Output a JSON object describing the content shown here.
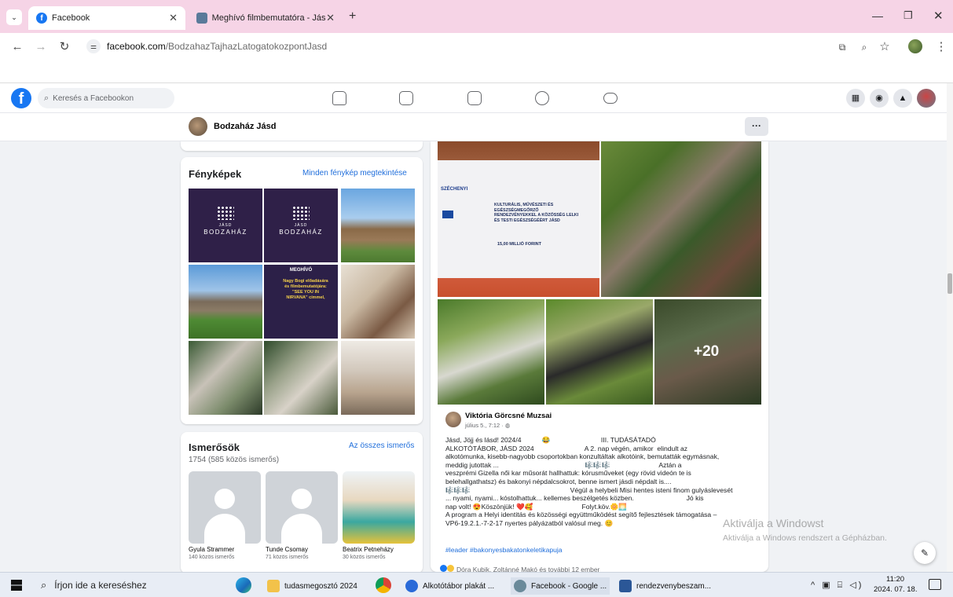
{
  "browser": {
    "tabs": [
      {
        "label": "Facebook"
      },
      {
        "label": "Meghívó filmbemutatóra - Jásd"
      }
    ],
    "url_domain": "facebook.com",
    "url_path": "/BodzahazTajhazLatogatokozpontJasd"
  },
  "fb": {
    "search_placeholder": "Keresés a Facebookon",
    "page_name": "Bodzaház Jásd",
    "more_label": "···"
  },
  "photos": {
    "title": "Fényképek",
    "see_all": "Minden fénykép megtekintése",
    "logo_text": "BODZAHÁZ",
    "logo_small": "JÁSD",
    "invite_head": "MEGHÍVÓ",
    "invite_body": "Nagy Bogi előadására és filmbemutatójára: \"SEE YOU IN NIRVANA\" címmel,"
  },
  "friends": {
    "title": "Ismerősök",
    "count": "1754 (585 közös ismerős)",
    "see_all": "Az összes ismerős",
    "items": [
      {
        "name": "Gyula Strammer",
        "mutual": "140 közös ismerős"
      },
      {
        "name": "Tunde Csomay",
        "mutual": "71 közös ismerős"
      },
      {
        "name": "Beatrix Petneházy",
        "mutual": "30 közös ismerős"
      }
    ]
  },
  "post": {
    "poster_text": "KULTURÁLIS, MŰVÉSZETI ÉS EGÉSZSÉGMEGŐRZŐ RENDEZVÉNYEKKEL A KÖZÖSSÉG LELKI ÉS TESTI EGÉSZSÉGÉÉRT JÁSD",
    "poster_amount": "15,00 MILLIÓ FORINT",
    "poster_brand": "SZÉCHENYI",
    "more_count": "+20",
    "author": "Viktória Görcsné Muzsai",
    "date": "július 5., 7:12 · ",
    "text": "Jásd, Jöjj és lásd! 2024/4           😂                           III. TUDÁSÁTADÓ\nALKOTÓTÁBOR, JÁSD 2024                           A 2. nap végén, amikor  elindult az\nalkotómunka, kisebb-nagyobb csoportokban konzultáltak alkotóink, bemutatták egymásnak,\nmeddig jutottak ...                                              🎼🎼🎼                          Aztán a\nveszprémi Gizella női kar műsorát hallhattuk: kórusműveket (egy rövid videón te is\nbelehallgathatsz) és bakonyi népdalcsokrot, benne ismert jásdi népdalt is....\n🎼🎼🎼                                                     Végül a helybeli Misi hentes isteni finom gulyáslevesét\n... nyami, nyami... kóstolhattuk... kellemes beszélgetés közben.                            Jó kis\nnap volt! 😍Köszönjük! ❤️🥰                          Folyt.köv.🌼🌅\nA program a Helyi identitás és közösségi együttműködést segítő fejlesztések támogatása –\nVP6-19.2.1.-7-2-17 nyertes pályázatból valósul meg. 😊",
    "hashtags": "#leader #bakonyesbakatonkeletikapuja",
    "reactions": "Dóra Kubik, Zoltánné Makó és további 12 ember"
  },
  "watermark": {
    "line1": "Aktiválja a Windowst",
    "line2": "Aktiválja a Windows rendszert a Gépházban."
  },
  "taskbar": {
    "search_placeholder": "Írjon ide a kereséshez",
    "apps": [
      {
        "label": "tudasmegosztó 2024"
      },
      {
        "label": "Alkotótábor plakát ..."
      },
      {
        "label": "Facebook - Google ..."
      },
      {
        "label": "rendezvenybeszam..."
      }
    ],
    "time": "11:20",
    "date": "2024. 07. 18."
  }
}
